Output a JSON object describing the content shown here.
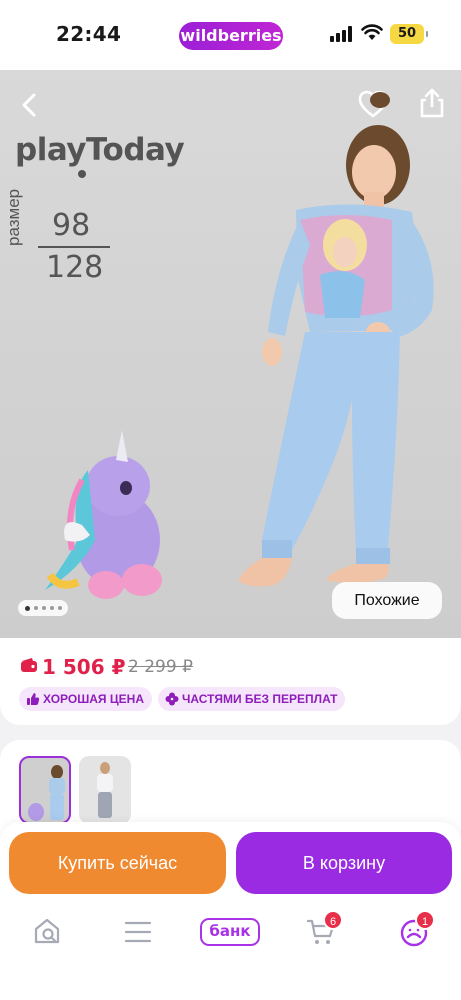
{
  "status_bar": {
    "time": "22:44",
    "brand": "wildberries",
    "battery": "50"
  },
  "hero": {
    "brand_logo": "playToday",
    "size_label": "размер",
    "size_top": "98",
    "size_bottom": "128",
    "similar_button": "Похожие",
    "carousel_dots": 5,
    "icons": [
      "back-arrow-icon",
      "heart-icon",
      "share-icon"
    ]
  },
  "price_block": {
    "price": "1 506 ₽",
    "old_price": "2 299 ₽",
    "badges": [
      {
        "label": "ХОРОШАЯ ЦЕНА",
        "icon": "thumbs-up-icon"
      },
      {
        "label": "ЧАСТЯМИ БЕЗ ПЕРЕПЛАТ",
        "icon": "clover-icon"
      }
    ]
  },
  "actions": {
    "buy_now": "Купить сейчас",
    "add_to_cart": "В корзину"
  },
  "tabbar": {
    "items": [
      "home-search-icon",
      "menu-icon",
      "bank-icon",
      "cart-icon",
      "profile-icon"
    ],
    "bank_label": "банк",
    "cart_count": "6",
    "profile_count": "1"
  },
  "colors": {
    "accent": "#9b2be3",
    "buy": "#f08a30",
    "price": "#e0224b"
  }
}
